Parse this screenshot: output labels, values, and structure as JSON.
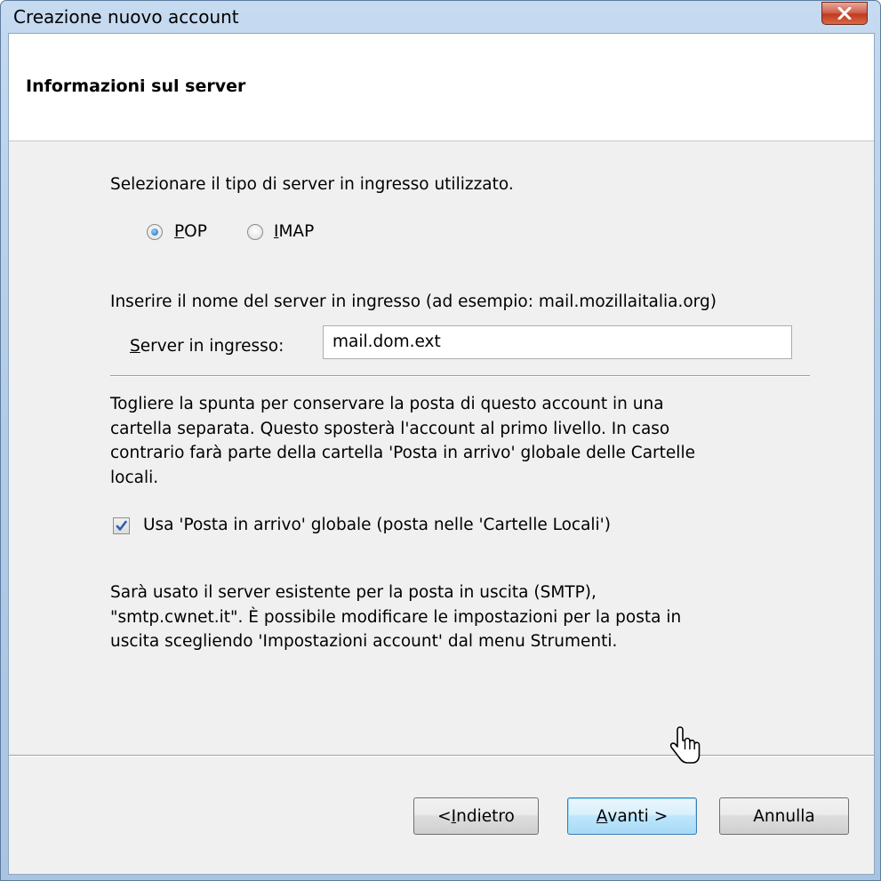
{
  "window": {
    "title": "Creazione nuovo account"
  },
  "header": {
    "title": "Informazioni sul server"
  },
  "server_type": {
    "prompt": "Selezionare il tipo di server in ingresso utilizzato.",
    "options": [
      {
        "label": "POP",
        "selected": true
      },
      {
        "label": "IMAP",
        "selected": false
      }
    ]
  },
  "incoming": {
    "prompt": "Inserire il nome del server in ingresso (ad esempio: mail.mozillaitalia.org)",
    "label": "Server in ingresso:",
    "value": "mail.dom.ext"
  },
  "global_inbox": {
    "description_lines": [
      "Togliere la spunta per conservare la posta di questo account in una",
      "cartella separata. Questo sposterà l'account al primo livello. In caso",
      "contrario farà parte della cartella 'Posta in arrivo' globale delle Cartelle",
      "locali."
    ],
    "checkbox_label": "Usa 'Posta in arrivo' globale (posta nelle 'Cartelle Locali')",
    "checked": true
  },
  "smtp_note_lines": [
    "Sarà usato il server esistente per la posta in uscita (SMTP),",
    "\"smtp.cwnet.it\". È possibile modificare le impostazioni per la posta in",
    "uscita scegliendo 'Impostazioni account' dal menu Strumenti."
  ],
  "buttons": {
    "back": "< Indietro",
    "next": "Avanti >",
    "cancel": "Annulla"
  },
  "colors": {
    "title_bar": "#b4cde8",
    "close_button": "#c23a20",
    "default_button_border": "#3c7fb1"
  }
}
